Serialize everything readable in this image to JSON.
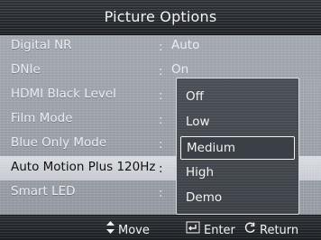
{
  "window": {
    "title": "Picture Options"
  },
  "menu": {
    "separator": ":",
    "items": [
      {
        "label": "Digital NR",
        "value": "Auto"
      },
      {
        "label": "DNIe",
        "value": "On"
      },
      {
        "label": "HDMI Black Level",
        "value": ""
      },
      {
        "label": "Film Mode",
        "value": ""
      },
      {
        "label": "Blue Only Mode",
        "value": ""
      },
      {
        "label": "Auto Motion Plus 120Hz",
        "value": ""
      },
      {
        "label": "Smart LED",
        "value": ""
      }
    ],
    "active_index": 5
  },
  "dropdown": {
    "options": [
      "Off",
      "Low",
      "Medium",
      "High",
      "Demo"
    ],
    "selected_index": 2
  },
  "footer": {
    "move_label": "Move",
    "enter_label": "Enter",
    "return_label": "Return",
    "icons": {
      "move": "updown-arrows-icon",
      "enter": "enter-icon",
      "return": "return-icon"
    }
  },
  "colors": {
    "title_bar": "#1e2226",
    "body": "#9aa0a8",
    "active_row": "#d0d4da",
    "dropdown_bg": "#3d4248",
    "text_light": "#f2f2f2",
    "text_dark": "#111111"
  }
}
